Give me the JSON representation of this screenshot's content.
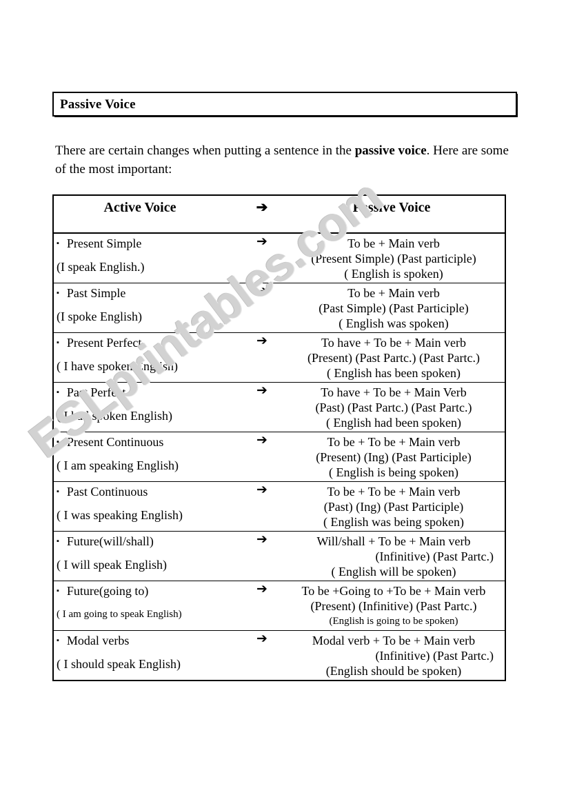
{
  "title": "Passive Voice",
  "intro": {
    "part1": "There are certain changes when putting a sentence in the ",
    "emphasis": "passive voice",
    "part2": ". Here are some of the most important:"
  },
  "watermark": "ESLprintables.com",
  "table": {
    "headers": {
      "active": "Active Voice",
      "arrow": "➔",
      "passive": "Passive Voice"
    },
    "bullet": "▪",
    "rows": [
      {
        "tense": "Present Simple",
        "example_active": "(I speak English.)",
        "arrow": "➔",
        "formula": "To be      +      Main verb",
        "parts": "(Present Simple)    (Past participle)",
        "example_passive": "( English is spoken)"
      },
      {
        "tense": "Past Simple",
        "example_active": "(I spoke English)",
        "arrow": "➔",
        "formula": "To be      +     Main verb",
        "parts": "(Past Simple)        (Past Participle)",
        "example_passive": "( English was spoken)"
      },
      {
        "tense": "Present Perfect",
        "example_active": "( I have spoken English)",
        "arrow": "➔",
        "formula": "To have  +  To be +   Main verb",
        "parts": "(Present) (Past Partc.) (Past Partc.)",
        "example_passive": "( English has been spoken)"
      },
      {
        "tense": "Past Perfect",
        "example_active": "( I had spoken English)",
        "arrow": "➔",
        "formula": "To have  +  To be  +  Main Verb",
        "parts": "(Past)    (Past Partc.)  (Past Partc.)",
        "example_passive": "( English had been spoken)"
      },
      {
        "tense": "Present Continuous",
        "example_active": "( I am speaking English)",
        "arrow": "➔",
        "formula": "To be  +   To be  +   Main verb",
        "parts": "(Present)    (Ing)      (Past Participle)",
        "example_passive": "( English is being spoken)"
      },
      {
        "tense": "Past Continuous",
        "example_active": "( I was speaking English)",
        "arrow": "➔",
        "formula": "To be  +   To be +  Main verb",
        "parts": "(Past)       (Ing)      (Past Participle)",
        "example_passive": "( English was being spoken)"
      },
      {
        "tense": "Future(will/shall)",
        "example_active": "( I will speak English)",
        "arrow": "➔",
        "formula": "Will/shall +  To be   +  Main verb",
        "parts": "(Infinitive)  (Past Partc.)",
        "example_passive": "( English will be spoken)"
      },
      {
        "tense": "Future(going to)",
        "example_active": "( I am going to speak English)",
        "arrow": "➔",
        "formula": "To be +Going to +To be + Main verb",
        "parts": "(Present)          (Infinitive)  (Past Partc.)",
        "example_passive": "(English is going to be spoken)"
      },
      {
        "tense": "Modal verbs",
        "example_active": "( I should speak English)",
        "arrow": "➔",
        "formula": "Modal verb + To be + Main verb",
        "parts": "(Infinitive) (Past Partc.)",
        "example_passive": "(English should be spoken)"
      }
    ]
  }
}
